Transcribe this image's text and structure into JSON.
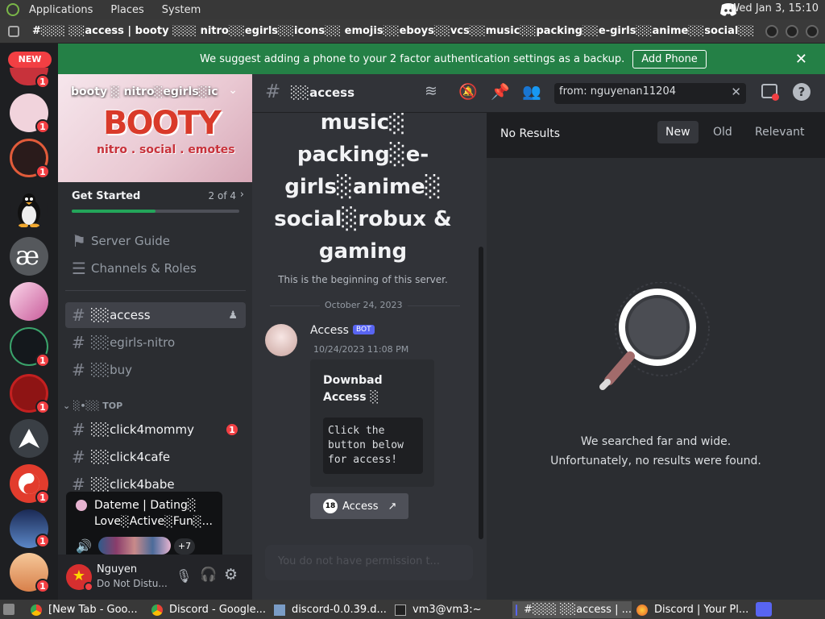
{
  "system_bar": {
    "menu": [
      "Applications",
      "Places",
      "System"
    ],
    "clock": "Wed Jan  3, 15:10"
  },
  "window": {
    "title": "#░░░ ░░access | booty ░░░ nitro░░egirls░░icons░░ emojis░░eboys░░vcs░░music░░packing░░e-girls░░anime░░social░░robux & gaming - ..."
  },
  "notice": {
    "text": "We suggest adding a phone to your 2 factor authentication settings as a backup.",
    "button": "Add Phone"
  },
  "servers": {
    "new_badge": "NEW",
    "badges": [
      "1",
      "1",
      "1",
      "1",
      "1",
      "1",
      "1",
      "1"
    ]
  },
  "sidebar": {
    "server_name": "booty ░ nitro░egirls░ic",
    "banner_title": "BOOTY",
    "banner_sub": "nitro . social . emotes",
    "get_started": "Get Started",
    "progress_count": "2 of 4",
    "progress_fraction": 0.5,
    "server_guide": "Server Guide",
    "channels_roles": "Channels & Roles",
    "channels": [
      "░░access",
      "░░egirls-nitro",
      "░░buy"
    ],
    "category": "░•░░ TOP",
    "top_channels": [
      "░░click4mommy",
      "░░click4cafe",
      "░░click4babe"
    ],
    "mention_badge": "1"
  },
  "popup": {
    "line1": "Dateme | Dating░",
    "line2": "Love░Active░Fun░...",
    "more": "+7"
  },
  "user": {
    "name": "Nguyen",
    "status": "Do Not Distu..."
  },
  "main": {
    "channel": "░░access",
    "welcome_lines": [
      "music░",
      "packing░e-",
      "girls░anime░",
      "social░robux &",
      "gaming"
    ],
    "beginning": "This is the beginning of this server.",
    "date_divider": "October 24, 2023",
    "author": "Access",
    "bot_tag": "BOT",
    "timestamp": "10/24/2023 11:08 PM",
    "embed_title": "Downbad Access ░",
    "embed_code": [
      "Click the",
      "button below",
      "for access!"
    ],
    "button_label": "Access",
    "button_badge": "18",
    "input_placeholder": "You do not have permission t..."
  },
  "search": {
    "query": "from: nguyenan11204",
    "no_results": "No Results",
    "sort_options": [
      "New",
      "Old",
      "Relevant"
    ],
    "empty_lines": [
      "We searched far and wide.",
      "Unfortunately, no results were found."
    ]
  },
  "taskbar": {
    "items": [
      "[New Tab - Goo...",
      "Discord - Google...",
      "discord-0.0.39.d...",
      "vm3@vm3:~",
      "#░░░ ░░access | ...",
      "Discord | Your Pl..."
    ]
  },
  "colors": {
    "accent": "#5865f2",
    "green": "#248046",
    "red": "#f23f43",
    "dark": "#1e1f22"
  }
}
